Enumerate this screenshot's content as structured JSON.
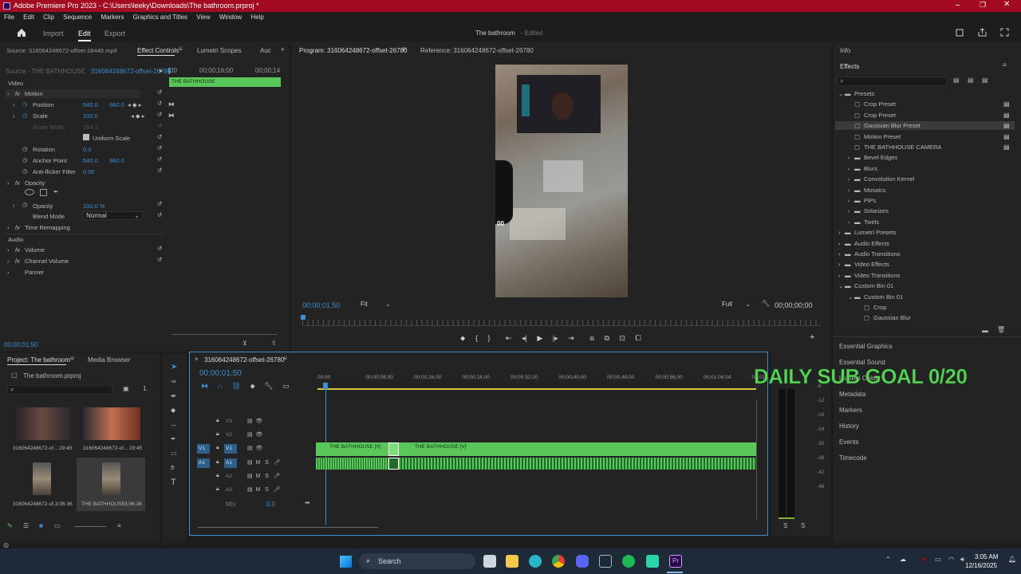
{
  "titlebar": {
    "title": "Adobe Premiere Pro 2023 - C:\\Users\\leeky\\Downloads\\The bathroom.prproj *"
  },
  "menu": [
    "File",
    "Edit",
    "Clip",
    "Sequence",
    "Markers",
    "Graphics and Titles",
    "View",
    "Window",
    "Help"
  ],
  "workspace": {
    "tabs": [
      "Import",
      "Edit",
      "Export"
    ],
    "project_name": "The bathroom",
    "status": "Edited"
  },
  "source_panel": {
    "tabs": [
      "Source: 316064248672-offset-28446.mp4",
      "Effect Controls",
      "Lumetri Scopes",
      "Auc"
    ],
    "clip_source": "Source - THE BATHHOUSE",
    "clip_sequence": "316064248672-offset-26780",
    "timecodes": [
      "00",
      "00;00;16;00",
      "00;00;14"
    ],
    "clip_bar_label": "THE BATHHOUSE",
    "video_label": "Video",
    "audio_label": "Audio",
    "props": {
      "motion": "Motion",
      "position": "Position",
      "position_x": "540.0",
      "position_y": "960.0",
      "scale": "Scale",
      "scale_val": "100.0",
      "scale_width": "Scale Width",
      "scale_width_val": "154.3",
      "uniform_scale": "Uniform Scale",
      "rotation": "Rotation",
      "rotation_val": "0.0",
      "anchor": "Anchor Point",
      "anchor_x": "540.0",
      "anchor_y": "960.0",
      "antiflicker": "Anti-flicker Filter",
      "antiflicker_val": "0.00",
      "opacity_group": "Opacity",
      "opacity": "Opacity",
      "opacity_val": "100.0 %",
      "blend": "Blend Mode",
      "blend_val": "Normal",
      "time_remap": "Time Remapping",
      "volume": "Volume",
      "channel_volume": "Channel Volume",
      "panner": "Panner"
    },
    "footer_timecode": "00;00;01;50"
  },
  "program": {
    "tab": "Program: 316064248672-offset-26780",
    "reference_tab": "Reference: 316064248672-offset-26780",
    "timecode": "00;00;01;50",
    "fit": "Fit",
    "quality": "Full",
    "duration": "00;00;00;00",
    "overlay_text": "00"
  },
  "project": {
    "tabs": [
      "Project: The bathroom",
      "Media Browser"
    ],
    "file": "The bathroom.prproj",
    "items": [
      {
        "name": "316064248672-of...",
        "duration": "29:45"
      },
      {
        "name": "316064248672-of...",
        "duration": "29:45"
      },
      {
        "name": "316064248672-of...",
        "duration": "3:06:36"
      },
      {
        "name": "THE BATHHOUSE",
        "duration": "3:06:36"
      }
    ]
  },
  "timeline": {
    "tab": "316064248672-offset-26780",
    "timecode": "00;00;01;50",
    "ruler": [
      "00;00",
      "00;00;08;00",
      "00;00;16;00",
      "00;00;24;00",
      "00;00;32;00",
      "00;00;40;00",
      "00;00;48;00",
      "00;00;56;00",
      "00;01;04;04",
      "00;01;1"
    ],
    "tracks_video": [
      "V3",
      "V2",
      "V1"
    ],
    "tracks_audio": [
      "A1",
      "A2",
      "A3"
    ],
    "mix": "Mix",
    "mix_val": "0.0",
    "clip1": "THE BATHHOUSE [V]",
    "clip2": "THE BATHHOUSE [V]",
    "meter_scale": [
      "-6",
      "-12",
      "-18",
      "-24",
      "-30",
      "-36",
      "-42",
      "-48"
    ],
    "solo": [
      "S",
      "S"
    ]
  },
  "overlay": {
    "sub_goal": "DAILY SUB GOAL 0/20"
  },
  "effects": {
    "info_tab": "Info",
    "tab": "Effects",
    "items": [
      {
        "label": "Presets",
        "level": 0,
        "type": "folder-open"
      },
      {
        "label": "Crop Preset",
        "level": 1,
        "type": "preset"
      },
      {
        "label": "Crop Preset",
        "level": 1,
        "type": "preset"
      },
      {
        "label": "Gaussian Blur Preset",
        "level": 1,
        "type": "preset",
        "selected": true
      },
      {
        "label": "Motion Preset",
        "level": 1,
        "type": "preset"
      },
      {
        "label": "THE BATHHOUSE CAMERA",
        "level": 1,
        "type": "preset"
      },
      {
        "label": "Bevel Edges",
        "level": 1,
        "type": "folder"
      },
      {
        "label": "Blurs",
        "level": 1,
        "type": "folder"
      },
      {
        "label": "Convolution Kernel",
        "level": 1,
        "type": "folder"
      },
      {
        "label": "Mosaics",
        "level": 1,
        "type": "folder"
      },
      {
        "label": "PiPs",
        "level": 1,
        "type": "folder"
      },
      {
        "label": "Solarizes",
        "level": 1,
        "type": "folder"
      },
      {
        "label": "Twirls",
        "level": 1,
        "type": "folder"
      },
      {
        "label": "Lumetri Presets",
        "level": 0,
        "type": "folder"
      },
      {
        "label": "Audio Effects",
        "level": 0,
        "type": "folder"
      },
      {
        "label": "Audio Transitions",
        "level": 0,
        "type": "folder"
      },
      {
        "label": "Video Effects",
        "level": 0,
        "type": "folder"
      },
      {
        "label": "Video Transitions",
        "level": 0,
        "type": "folder"
      },
      {
        "label": "Custom Bin 01",
        "level": 0,
        "type": "folder-open"
      },
      {
        "label": "Custom Bin 01",
        "level": 1,
        "type": "folder-open"
      },
      {
        "label": "Crop",
        "level": 2,
        "type": "preset"
      },
      {
        "label": "Gaussian Blur",
        "level": 2,
        "type": "preset"
      }
    ],
    "side_panels": [
      "Essential Graphics",
      "Essential Sound",
      "Lumetri Color",
      "Metadata",
      "Markers",
      "History",
      "Events",
      "Timecode"
    ]
  },
  "taskbar": {
    "search": "Search",
    "time": "3:05 AM",
    "date": "12/16/2025"
  },
  "colors": {
    "accent": "#3e8ed0",
    "clip": "#5bc75b",
    "title": "#a20b21",
    "overlay": "#5bd35b"
  }
}
